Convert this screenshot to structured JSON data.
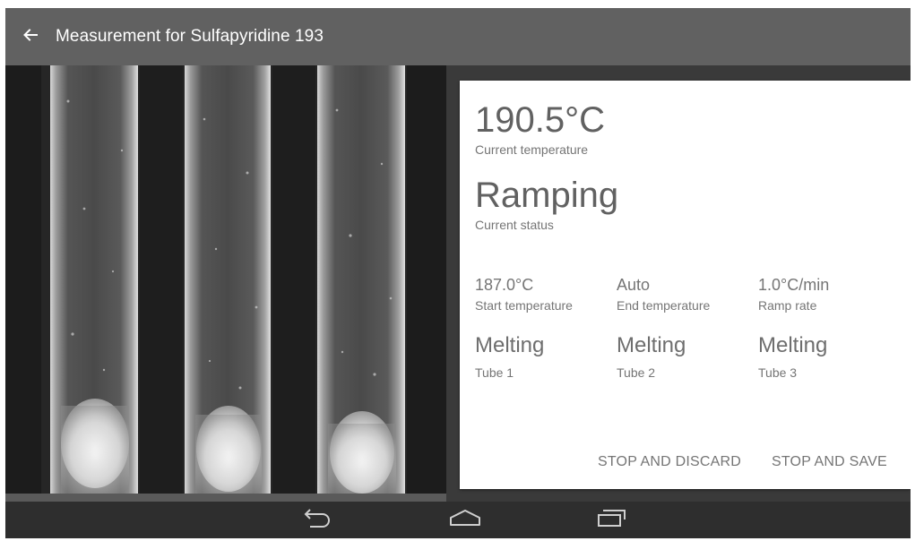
{
  "app_bar": {
    "title": "Measurement for Sulfapyridine 193",
    "back_icon": "arrow-back-icon"
  },
  "camera": {
    "description_icon": "capillary-tubes-image",
    "tube_count": 3
  },
  "status_card": {
    "current_temperature": {
      "value": "190.5°C",
      "label": "Current temperature"
    },
    "current_status": {
      "value": "Ramping",
      "label": "Current status"
    },
    "parameters": [
      {
        "value": "187.0°C",
        "label": "Start temperature"
      },
      {
        "value": "Auto",
        "label": "End temperature"
      },
      {
        "value": "1.0°C/min",
        "label": "Ramp rate"
      }
    ],
    "tubes": [
      {
        "state": "Melting",
        "label": "Tube 1"
      },
      {
        "state": "Melting",
        "label": "Tube 2"
      },
      {
        "state": "Melting",
        "label": "Tube 3"
      }
    ],
    "actions": {
      "stop_discard": "STOP AND DISCARD",
      "stop_save": "STOP AND SAVE"
    }
  },
  "nav_bar": {
    "back": "back-icon",
    "home": "home-icon",
    "recents": "recents-icon"
  },
  "colors": {
    "app_bar": "#616161",
    "nav_bar": "#2e2e2e",
    "card_bg": "#ffffff",
    "text_primary": "#616161",
    "text_secondary": "#757575"
  }
}
